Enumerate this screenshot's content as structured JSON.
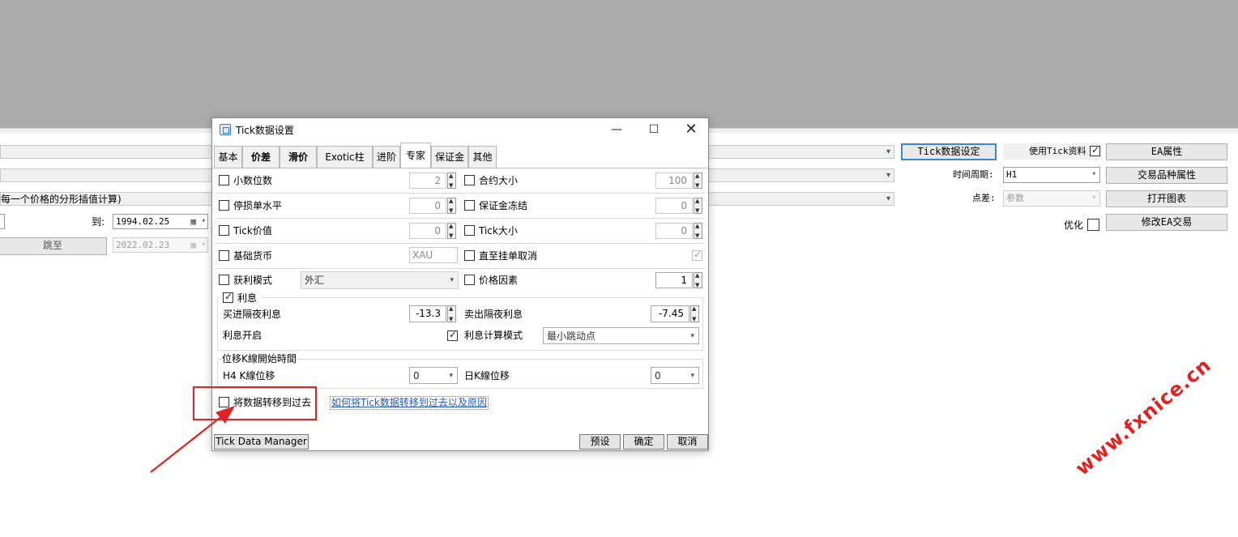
{
  "background": {
    "row3_text": "每一个价格的分形插值计算)",
    "to_label": "到:",
    "date_to": "1994.02.25",
    "jump_button": "跳至",
    "date_jump": "2022.02.23",
    "tick_settings_button": "Tick数据设定",
    "use_tick_label": "使用Tick资料",
    "ea_props_button": "EA属性",
    "period_label": "时间周期:",
    "period_value": "H1",
    "symbol_props_button": "交易品种属性",
    "spread_label": "点差:",
    "spread_value": "参数",
    "open_chart_button": "打开图表",
    "optimize_label": "优化",
    "modify_ea_button": "修改EA交易"
  },
  "dialog": {
    "title": "Tick数据设置",
    "tabs": [
      {
        "label": "基本"
      },
      {
        "label": "价差"
      },
      {
        "label": "滑价"
      },
      {
        "label": "Exotic柱"
      },
      {
        "label": "进阶"
      },
      {
        "label": "专家"
      },
      {
        "label": "保证金"
      },
      {
        "label": "其他"
      }
    ],
    "rows": {
      "digits_label": "小数位数",
      "digits_value": "2",
      "contract_label": "合约大小",
      "contract_value": "100",
      "stoplevel_label": "停损单水平",
      "stoplevel_value": "0",
      "freeze_label": "保证金冻结",
      "freeze_value": "0",
      "tickvalue_label": "Tick价值",
      "tickvalue_value": "0",
      "ticksize_label": "Tick大小",
      "ticksize_value": "0",
      "basecurrency_label": "基础货币",
      "basecurrency_value": "XAU",
      "gtc_label": "直至挂单取消",
      "profitmode_label": "获利模式",
      "profitmode_value": "外汇",
      "pricefactor_label": "价格因素",
      "pricefactor_value": "1"
    },
    "swap": {
      "group_label": "利息",
      "buy_label": "买进隔夜利息",
      "buy_value": "-13.3",
      "sell_label": "卖出隔夜利息",
      "sell_value": "-7.45",
      "enable_label": "利息开启",
      "calcmode_label": "利息计算模式",
      "calcmode_value": "最小跳动点"
    },
    "shift": {
      "group_label": "位移K線開始時間",
      "h4_label": "H4 K線位移",
      "h4_value": "0",
      "d1_label": "日K線位移",
      "d1_value": "0"
    },
    "move_past_label": "将数据转移到过去",
    "help_link": "如何将Tick数据转移到过去以及原因",
    "footer": {
      "manager": "Tick Data Manager",
      "preset": "预设",
      "ok": "确定",
      "cancel": "取消"
    }
  },
  "watermark": "www.fxnice.cn",
  "colors": {
    "highlight_box": "#e02424",
    "arrow": "#e02424",
    "link": "#2359c7",
    "focus_border": "#3c86d8"
  }
}
